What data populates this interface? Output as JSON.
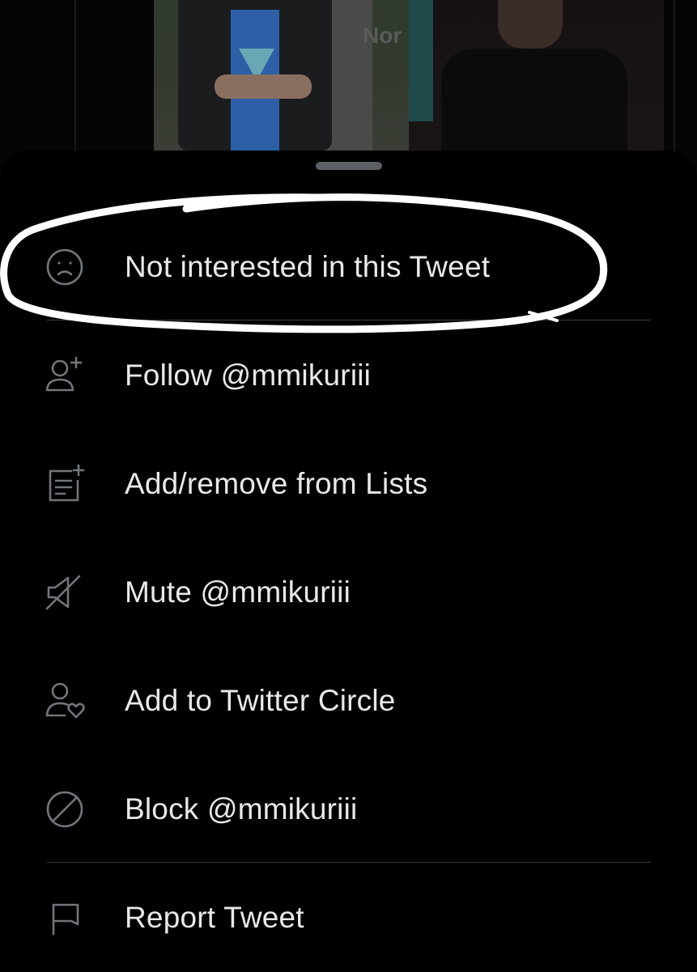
{
  "media": {
    "overlay_text": "Nor"
  },
  "menu": {
    "items": [
      {
        "label": "Not interested in this Tweet",
        "icon": "frown-face-icon"
      },
      {
        "label": "Follow @mmikuriii",
        "icon": "follow-user-icon"
      },
      {
        "label": "Add/remove from Lists",
        "icon": "add-list-icon"
      },
      {
        "label": "Mute @mmikuriii",
        "icon": "mute-speaker-icon"
      },
      {
        "label": "Add to Twitter Circle",
        "icon": "user-heart-icon"
      },
      {
        "label": "Block @mmikuriii",
        "icon": "block-icon"
      },
      {
        "label": "Report Tweet",
        "icon": "flag-icon"
      }
    ]
  },
  "colors": {
    "background": "#000000",
    "text": "#e7e9ea",
    "icon": "#71767b",
    "divider": "#3a3d41",
    "annotation": "#ffffff"
  }
}
